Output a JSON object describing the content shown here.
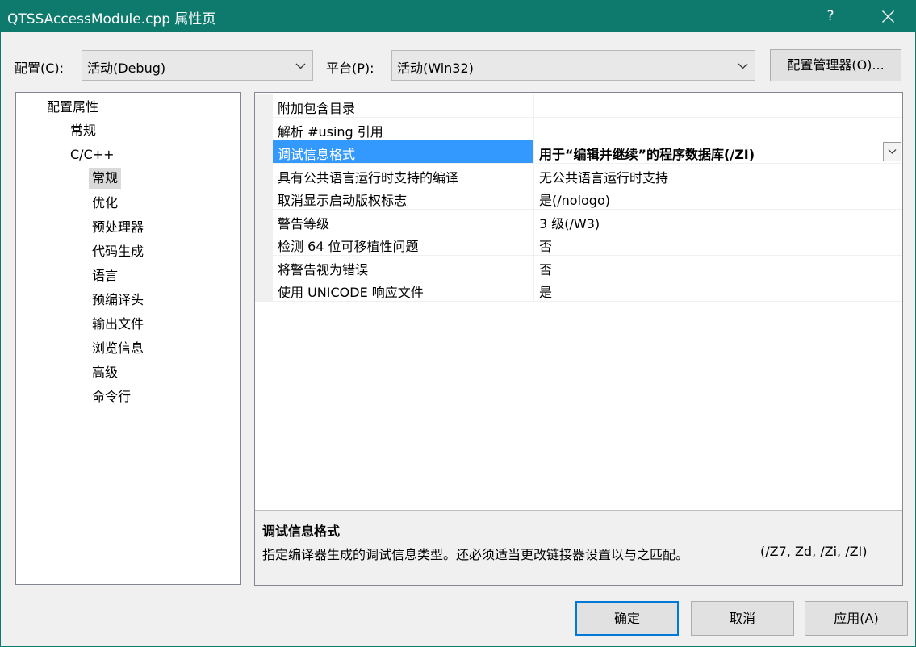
{
  "window": {
    "title": "QTSSAccessModule.cpp 属性页",
    "help_label": "?",
    "title_bar_color": "#0e7a6e"
  },
  "config": {
    "label": "配置(C):",
    "value": "活动(Debug)"
  },
  "platform": {
    "label": "平台(P):",
    "value": "活动(Win32)"
  },
  "config_manager_button": "配置管理器(O)...",
  "tree": {
    "root": "配置属性",
    "general": "常规",
    "cpp": "C/C++",
    "children": [
      "常规",
      "优化",
      "预处理器",
      "代码生成",
      "语言",
      "预编译头",
      "输出文件",
      "浏览信息",
      "高级",
      "命令行"
    ]
  },
  "properties": [
    {
      "name": "附加包含目录",
      "value": ""
    },
    {
      "name": "解析 #using 引用",
      "value": ""
    },
    {
      "name": "调试信息格式",
      "value": "用于“编辑并继续”的程序数据库(/ZI)"
    },
    {
      "name": "具有公共语言运行时支持的编译",
      "value": "无公共语言运行时支持"
    },
    {
      "name": "取消显示启动版权标志",
      "value": "是(/nologo)"
    },
    {
      "name": "警告等级",
      "value": "3 级(/W3)"
    },
    {
      "name": "检测 64 位可移植性问题",
      "value": "否"
    },
    {
      "name": "将警告视为错误",
      "value": "否"
    },
    {
      "name": "使用 UNICODE 响应文件",
      "value": "是"
    }
  ],
  "description": {
    "title": "调试信息格式",
    "text": "指定编译器生成的调试信息类型。还必须适当更改链接器设置以与之匹配。",
    "flags": "(/Z7, Zd, /Zi, /ZI)"
  },
  "buttons": {
    "ok": "确定",
    "cancel": "取消",
    "apply": "应用(A)"
  },
  "colors": {
    "selection": "#3399ff",
    "primary_border": "#0078d7"
  },
  "icons": [
    "close-icon",
    "chevron-down-icon"
  ]
}
